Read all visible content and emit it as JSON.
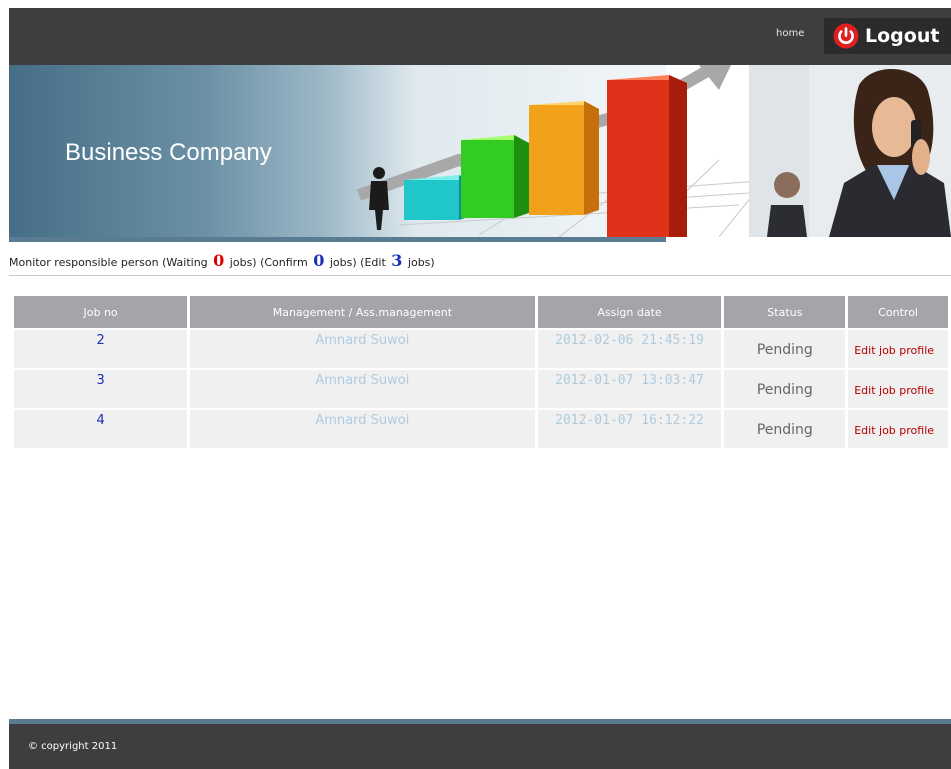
{
  "header": {
    "home_label": "home",
    "logout_label": "Logout"
  },
  "banner": {
    "company_name": "Business Company"
  },
  "monitor": {
    "prefix": "Monitor responsible person (Waiting",
    "waiting_count": "0",
    "mid1": "jobs) (Confirm",
    "confirm_count": "0",
    "mid2": "jobs) (Edit",
    "edit_count": "3",
    "suffix": "jobs)"
  },
  "table": {
    "headers": [
      "Job no",
      "Management / Ass.management",
      "Assign date",
      "Status",
      "Control"
    ],
    "rows": [
      {
        "job_no": "2",
        "manager": "Amnard Suwoi",
        "assign_date": "2012-02-06 21:45:19",
        "status": "Pending",
        "control": "Edit job profile"
      },
      {
        "job_no": "3",
        "manager": "Amnard Suwoi",
        "assign_date": "2012-01-07 13:03:47",
        "status": "Pending",
        "control": "Edit job profile"
      },
      {
        "job_no": "4",
        "manager": "Amnard Suwoi",
        "assign_date": "2012-01-07 16:12:22",
        "status": "Pending",
        "control": "Edit job profile"
      }
    ]
  },
  "footer": {
    "copyright": "© copyright 2011"
  },
  "colors": {
    "topbar": "#3e3e3e",
    "accent_blue": "#1a2fb5",
    "alert_red": "#dd0000",
    "link_red": "#b30000"
  }
}
